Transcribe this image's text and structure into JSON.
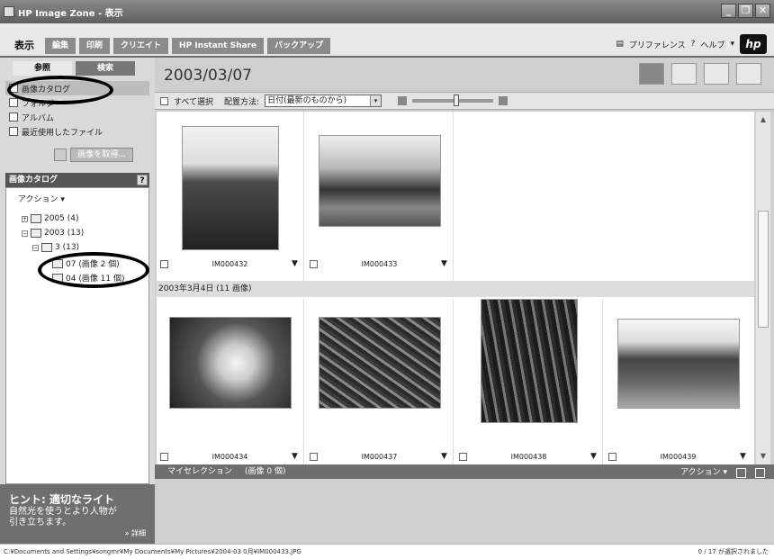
{
  "window": {
    "title": "HP Image Zone - 表示"
  },
  "tabs": [
    {
      "label": "表示"
    },
    {
      "label": "編集"
    },
    {
      "label": "印刷"
    },
    {
      "label": "クリエイト"
    },
    {
      "label": "HP Instant Share"
    },
    {
      "label": "バックアップ"
    }
  ],
  "help": {
    "preferences": "プリファレンス",
    "help_label": "ヘルプ",
    "logo": "hp"
  },
  "sidebar": {
    "tabs": [
      {
        "label": "参照"
      },
      {
        "label": "検索"
      }
    ],
    "nav": [
      {
        "label": "画像カタログ"
      },
      {
        "label": "フォルダ"
      },
      {
        "label": "アルバム"
      },
      {
        "label": "最近使用したファイル"
      }
    ],
    "get_images": "画像を取得...",
    "catalog_header": "画像カタログ",
    "action": "アクション ▾",
    "tree": [
      {
        "label": "2005 (4)"
      },
      {
        "label": "2003 (13)"
      },
      {
        "label": "3 (13)"
      },
      {
        "label": "07 (画像 2 個)"
      },
      {
        "label": "04 (画像 11 個)"
      }
    ],
    "hint": {
      "title": "ヒント: 適切なライト",
      "body_1": "自然光を使うとより人物が",
      "body_2": "引き立ちます。",
      "more": "» 詳細"
    }
  },
  "main": {
    "date_title": "2003/03/07",
    "toolbar": {
      "select_all": "すべて選択",
      "sort_label": "配置方法:",
      "sort_value": "日付(最新のものから)"
    },
    "group_header": "2003年3月4日 (11 画像)",
    "images": [
      {
        "name": "IM000432"
      },
      {
        "name": "IM000433"
      },
      {
        "name": "IM000434"
      },
      {
        "name": "IM000437"
      },
      {
        "name": "IM000438"
      },
      {
        "name": "IM000439"
      }
    ],
    "my_selection": {
      "label": "マイセレクション",
      "count": "(画像 0 個)",
      "action": "アクション ▾"
    }
  },
  "status": {
    "path": "C:¥Documents and Settings¥songmr¥My Documents¥My Pictures¥2004-03 0月¥IM000433.JPG",
    "selection": "0 / 17 が選択されました"
  }
}
